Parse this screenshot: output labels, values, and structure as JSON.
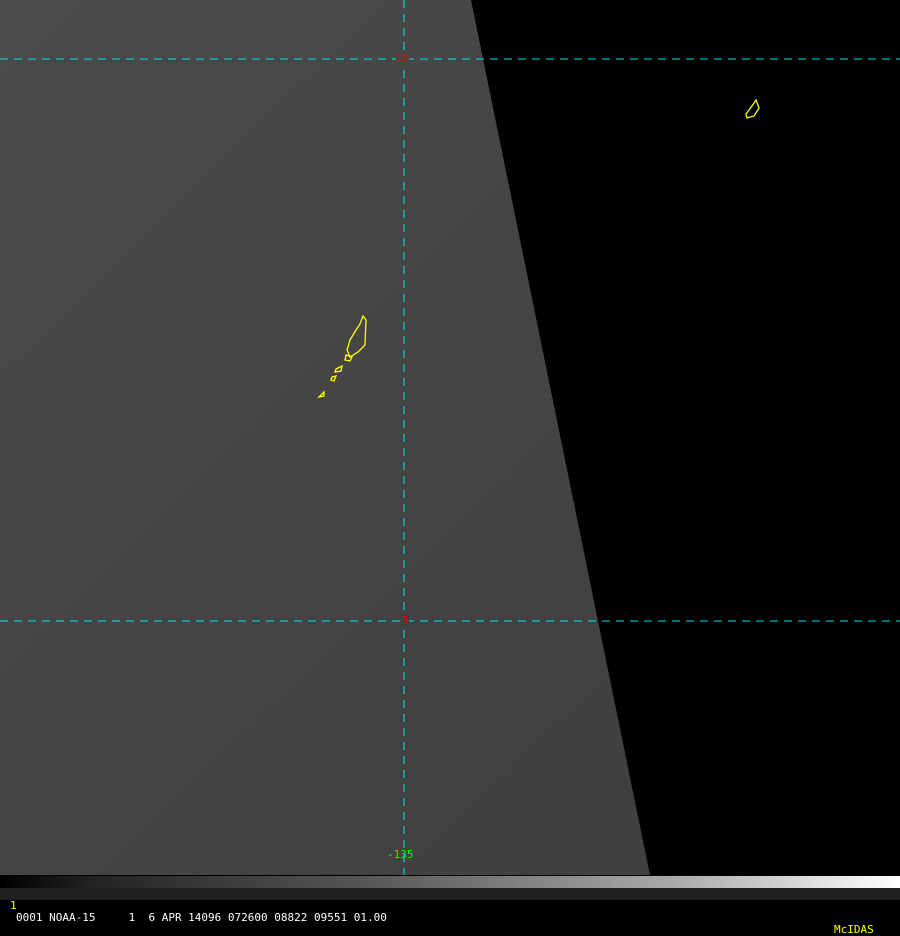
{
  "grid": {
    "lat_labels": [
      "10",
      "5"
    ],
    "lon_labels": [
      "-135"
    ],
    "line_color": "#00e5e5",
    "lat_label_color": "#ff0000",
    "lon_label_color": "#00ff00",
    "coast_color": "#ffff00"
  },
  "status_bar": {
    "frame": "1",
    "info": "0001 NOAA-15     1  6 APR 14096 072600 08822 09551 01.00",
    "brand": "McIDAS"
  }
}
